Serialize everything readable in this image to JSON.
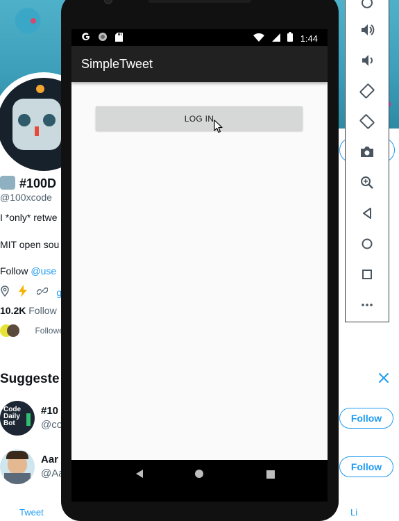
{
  "background_page": {
    "profile": {
      "display_name": "#100D",
      "handle": "@100xcode",
      "bio_line_1": "I *only* retwe",
      "bio_line_2": "MIT open sou",
      "follow_prefix": "Follow",
      "follow_link": "@use",
      "website_fragment": "g",
      "followers_count": "10.2K",
      "followers_label": "Follow",
      "followed_by_text": "Followe"
    },
    "suggestions": {
      "heading": "Suggeste",
      "items": [
        {
          "name": "#10",
          "handle": "@co",
          "avatar_text": "Code Daily Bot",
          "follow_label": "Follow"
        },
        {
          "name": "Aar",
          "handle": "@Aa",
          "follow_label": "Follow"
        }
      ]
    },
    "bottom_tabs": {
      "left": "Tweet",
      "right": "Li"
    },
    "accent_color": "#1d9bf0"
  },
  "emulator": {
    "status_bar": {
      "time": "1:44",
      "left_icons": [
        "google-g-icon",
        "circle-dot-icon",
        "sd-card-icon"
      ],
      "right_icons": [
        "wifi-icon",
        "signal-icon",
        "battery-icon"
      ]
    },
    "app": {
      "title": "SimpleTweet",
      "login_button_label": "LOG IN",
      "app_bar_color": "#212121",
      "button_color": "#d6d7d7"
    },
    "nav_bar": [
      "back-icon",
      "home-icon",
      "recents-icon"
    ]
  },
  "emulator_toolbar": {
    "buttons": [
      "power-icon",
      "volume-up-icon",
      "volume-down-icon",
      "rotate-left-icon",
      "rotate-right-icon",
      "camera-icon",
      "zoom-icon",
      "back-icon",
      "home-icon",
      "overview-icon",
      "more-icon"
    ]
  }
}
